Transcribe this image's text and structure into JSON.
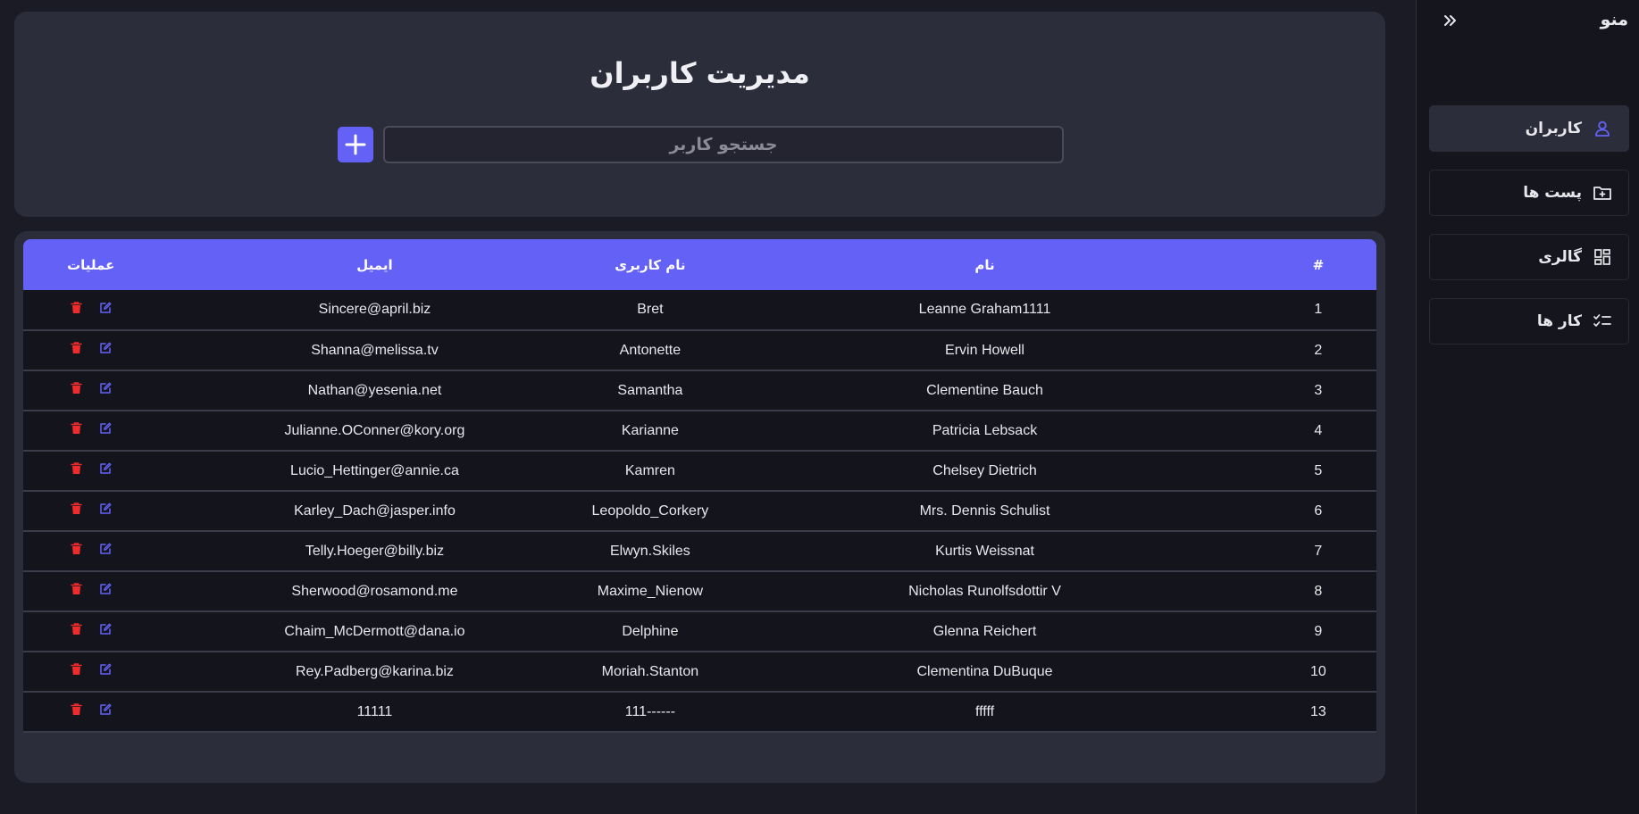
{
  "header": {
    "title": "مدیریت کاربران",
    "search_placeholder": "جستجو کاربر",
    "add_icon": "plus-icon"
  },
  "table": {
    "columns": {
      "id": "#",
      "name": "نام",
      "username": "نام کاربری",
      "email": "ایمیل",
      "actions": "عملیات"
    },
    "rows": [
      {
        "id": "1",
        "name": "Leanne Graham1111",
        "username": "Bret",
        "email": "Sincere@april.biz"
      },
      {
        "id": "2",
        "name": "Ervin Howell",
        "username": "Antonette",
        "email": "Shanna@melissa.tv"
      },
      {
        "id": "3",
        "name": "Clementine Bauch",
        "username": "Samantha",
        "email": "Nathan@yesenia.net"
      },
      {
        "id": "4",
        "name": "Patricia Lebsack",
        "username": "Karianne",
        "email": "Julianne.OConner@kory.org"
      },
      {
        "id": "5",
        "name": "Chelsey Dietrich",
        "username": "Kamren",
        "email": "Lucio_Hettinger@annie.ca"
      },
      {
        "id": "6",
        "name": "Mrs. Dennis Schulist",
        "username": "Leopoldo_Corkery",
        "email": "Karley_Dach@jasper.info"
      },
      {
        "id": "7",
        "name": "Kurtis Weissnat",
        "username": "Elwyn.Skiles",
        "email": "Telly.Hoeger@billy.biz"
      },
      {
        "id": "8",
        "name": "Nicholas Runolfsdottir V",
        "username": "Maxime_Nienow",
        "email": "Sherwood@rosamond.me"
      },
      {
        "id": "9",
        "name": "Glenna Reichert",
        "username": "Delphine",
        "email": "Chaim_McDermott@dana.io"
      },
      {
        "id": "10",
        "name": "Clementina DuBuque",
        "username": "Moriah.Stanton",
        "email": "Rey.Padberg@karina.biz"
      },
      {
        "id": "13",
        "name": "fffff",
        "username": "------111",
        "email": "11111"
      }
    ],
    "row_actions": [
      "trash-icon",
      "edit-icon"
    ]
  },
  "sidebar": {
    "title": "منو",
    "collapse_icon": "double-chevron-right-icon",
    "items": [
      {
        "label": "کاربران",
        "icon": "user-icon",
        "active": true
      },
      {
        "label": "پست ها",
        "icon": "folder-plus-icon",
        "active": false
      },
      {
        "label": "گالری",
        "icon": "grid-icon",
        "active": false
      },
      {
        "label": "کار ها",
        "icon": "checklist-icon",
        "active": false
      }
    ]
  },
  "colors": {
    "accent": "#6461f7",
    "danger": "#ef2b2b",
    "card": "#2c2d3b",
    "background": "#14151d"
  }
}
